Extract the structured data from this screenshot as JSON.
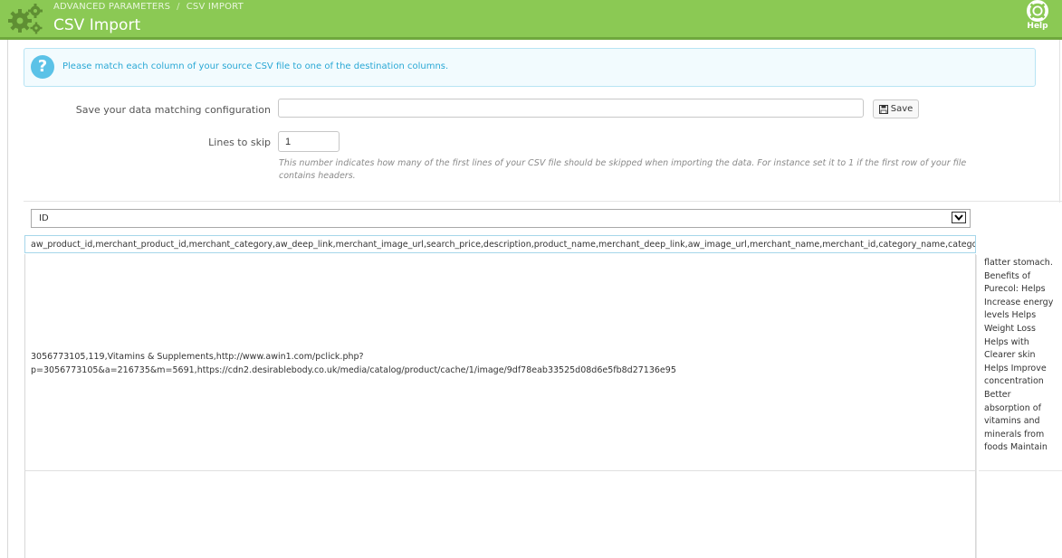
{
  "header": {
    "breadcrumb": [
      "ADVANCED PARAMETERS",
      "CSV IMPORT"
    ],
    "breadcrumb_separator": "/",
    "title": "CSV Import",
    "help_label": "Help",
    "gear_icon": "gears-icon",
    "help_icon": "lifebuoy-icon"
  },
  "info": {
    "icon": "question-icon",
    "message": "Please match each column of your source CSV file to one of the destination columns."
  },
  "form": {
    "save_config_label": "Save your data matching configuration",
    "save_config_value": "",
    "save_button_label": "Save",
    "save_icon": "floppy-disk-icon",
    "lines_to_skip_label": "Lines to skip",
    "lines_to_skip_value": "1",
    "lines_to_skip_help": "This number indicates how many of the first lines of your CSV file should be skipped when importing the data. For instance set it to 1 if the first row of your file contains headers."
  },
  "columns_table": {
    "selected_column": "ID",
    "header_cell": "aw_product_id,merchant_product_id,merchant_category,aw_deep_link,merchant_image_url,search_price,description,product_name,merchant_deep_link,aw_image_url,merchant_name,merchant_id,category_name,catego",
    "row1_line1": "3056773105,119,Vitamins & Supplements,http://www.awin1.com/pclick.php?",
    "row1_line2": "p=3056773105&a=216735&m=5691,https://cdn2.desirablebody.co.uk/media/catalog/product/cache/1/image/9df78eab33525d08d6e5fb8d27136e95",
    "side_text": "flatter stomach. Benefits of Purecol: Helps Increase energy levels Helps Weight Loss Helps with Clearer skin Helps Improve concentration Better absorption of vitamins and minerals from foods Maintain"
  },
  "colors": {
    "header_green": "#8bc954",
    "info_blue": "#5bc2e7",
    "info_text": "#2aa8d5"
  }
}
